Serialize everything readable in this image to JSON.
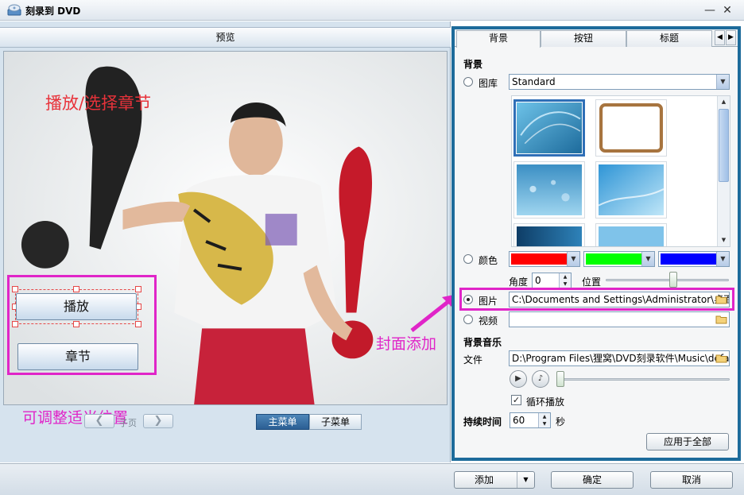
{
  "window": {
    "title": "刻录到 DVD",
    "minimize_glyph": "—",
    "close_glyph": "✕"
  },
  "preview": {
    "header": "预览",
    "annotation_top": "播放/选择章节",
    "annotation_bottom": "可调整适当位置",
    "buttons": [
      "播放",
      "章节"
    ],
    "nav": {
      "prev_glyph": "❮",
      "next_glyph": "❯",
      "page_label": "子页"
    },
    "menu_tabs": [
      "主菜单",
      "子菜单"
    ]
  },
  "annotation_arrow_text": "封面添加",
  "tabs": {
    "items": [
      "背景",
      "按钮",
      "标题"
    ],
    "active": "背景",
    "scroll_left": "◀",
    "scroll_right": "▶"
  },
  "background": {
    "section_title": "背景",
    "library_label": "图库",
    "library_value": "Standard",
    "color_label": "颜色",
    "colors": [
      "#ff0000",
      "#00ff00",
      "#0000ff"
    ],
    "angle_label": "角度",
    "angle_value": "0",
    "position_label": "位置",
    "position_fraction": 0.55,
    "picture_label": "图片",
    "picture_path": "C:\\Documents and Settings\\Administrator\\桌面",
    "video_label": "视频",
    "video_path": ""
  },
  "music": {
    "section_title": "背景音乐",
    "file_label": "文件",
    "file_path": "D:\\Program Files\\狸窝\\DVD刻录软件\\Music\\defa",
    "loop_label": "循环播放",
    "loop_checked": true,
    "duration_label": "持续时间",
    "duration_value": "60",
    "duration_unit": "秒",
    "apply_all": "应用于全部"
  },
  "footer": {
    "add": "添加",
    "ok": "确定",
    "cancel": "取消"
  },
  "icons": {
    "app": "dvd-burn-icon",
    "folder": "folder-icon",
    "play": "play-icon",
    "music": "music-note-icon"
  }
}
